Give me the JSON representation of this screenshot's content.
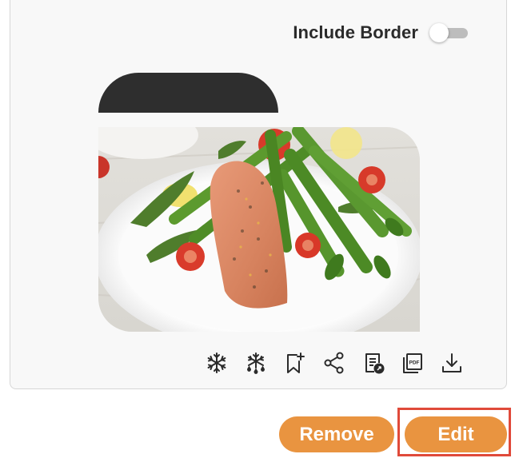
{
  "header": {
    "toggle_label": "Include Border",
    "include_border_enabled": false
  },
  "preview": {
    "image_subject": "plate of salmon fillet with asparagus, arugula and cherry tomatoes"
  },
  "toolbar": {
    "icons": [
      "snowflake-icon",
      "snowflake-drop-icon",
      "bookmark-add-icon",
      "share-icon",
      "document-link-icon",
      "pdf-icon",
      "download-icon"
    ]
  },
  "actions": {
    "remove_label": "Remove",
    "edit_label": "Edit"
  },
  "colors": {
    "accent": "#e99440",
    "highlight": "#e04a3a",
    "tab": "#2e2e2e"
  }
}
